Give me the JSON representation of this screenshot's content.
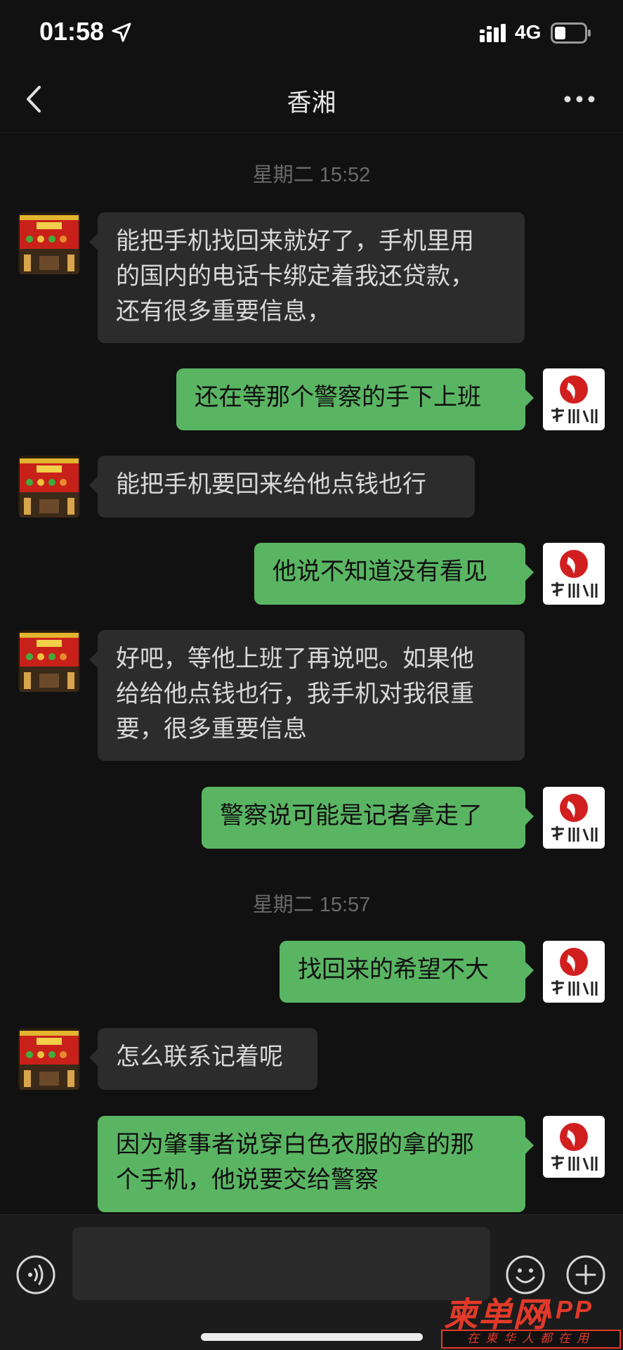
{
  "status_bar": {
    "time": "01:58",
    "network": "4G",
    "icons": [
      "location-arrow-icon",
      "signal-icon",
      "battery-icon"
    ]
  },
  "nav": {
    "title": "香湘",
    "back_icon": "chevron-left-icon",
    "more_icon": "more-dots-icon"
  },
  "messages": [
    {
      "type": "time",
      "text": "星期二 15:52"
    },
    {
      "type": "in",
      "lines": [
        "能把手机找回来就好了，手机里用",
        "的国内的电话卡绑定着我还贷款，",
        "还有很多重要信息，"
      ]
    },
    {
      "type": "out",
      "lines": [
        "还在等那个警察的手下上班"
      ]
    },
    {
      "type": "in",
      "lines": [
        "能把手机要回来给他点钱也行"
      ]
    },
    {
      "type": "out",
      "lines": [
        "他说不知道没有看见"
      ]
    },
    {
      "type": "in",
      "lines": [
        "好吧，等他上班了再说吧。如果他",
        "给给他点钱也行，我手机对我很重",
        "要，很多重要信息"
      ]
    },
    {
      "type": "out",
      "lines": [
        "警察说可能是记者拿走了"
      ]
    },
    {
      "type": "time",
      "text": "星期二 15:57"
    },
    {
      "type": "out",
      "lines": [
        "找回来的希望不大"
      ]
    },
    {
      "type": "in",
      "lines": [
        "怎么联系记着呢"
      ]
    },
    {
      "type": "out",
      "lines": [
        "因为肇事者说穿白色衣服的拿的那",
        "个手机，他说要交给警察"
      ]
    }
  ],
  "input_bar": {
    "icons": [
      "voice-icon",
      "emoji-icon",
      "plus-icon"
    ]
  },
  "watermark": {
    "brand": "柬单网",
    "app": "APP",
    "slogan": "在柬华人都在用"
  },
  "colors": {
    "background": "#111111",
    "incoming_bubble": "#2c2c2c",
    "outgoing_bubble": "#5ab563",
    "watermark": "#e23a2a"
  }
}
